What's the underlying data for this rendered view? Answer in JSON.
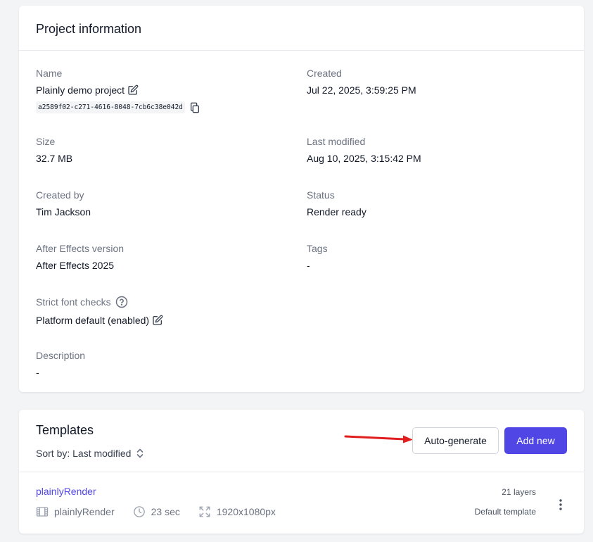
{
  "project": {
    "title": "Project information",
    "name_label": "Name",
    "name_value": "Plainly demo project",
    "uuid": "a2589f02-c271-4616-8048-7cb6c38e042d",
    "created_label": "Created",
    "created_value": "Jul 22, 2025, 3:59:25 PM",
    "size_label": "Size",
    "size_value": "32.7 MB",
    "modified_label": "Last modified",
    "modified_value": "Aug 10, 2025, 3:15:42 PM",
    "created_by_label": "Created by",
    "created_by_value": "Tim Jackson",
    "status_label": "Status",
    "status_value": "Render ready",
    "ae_label": "After Effects version",
    "ae_value": "After Effects 2025",
    "tags_label": "Tags",
    "tags_value": "-",
    "font_checks_label": "Strict font checks",
    "font_checks_value": "Platform default (enabled)",
    "description_label": "Description",
    "description_value": "-"
  },
  "templates": {
    "title": "Templates",
    "sort_label": "Sort by: Last modified",
    "auto_generate_label": "Auto-generate",
    "add_new_label": "Add new",
    "items": [
      {
        "name": "plainlyRender",
        "composition": "plainlyRender",
        "duration": "23 sec",
        "resolution": "1920x1080px",
        "layers": "21 layers",
        "badge": "Default template"
      }
    ]
  },
  "colors": {
    "primary": "#4f46e5",
    "annotation_arrow": "#e11d1d"
  },
  "icons": {
    "edit": "pencil-icon",
    "copy": "copy-icon",
    "help": "question-circle-icon",
    "sort": "chevron-up-down-icon",
    "film": "film-icon",
    "clock": "clock-icon",
    "resolution": "expand-icon",
    "more": "kebab-icon"
  }
}
